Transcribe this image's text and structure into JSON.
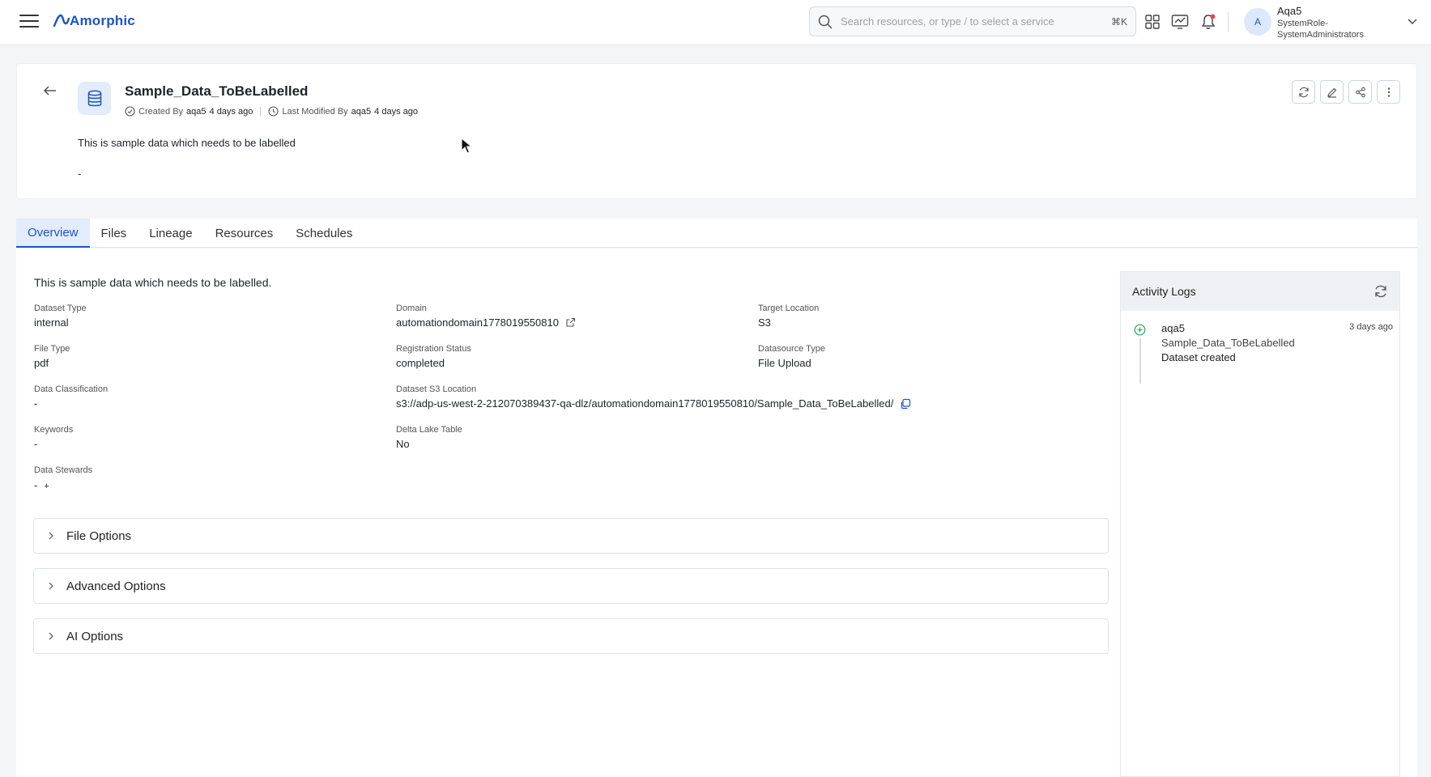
{
  "app": {
    "logo_text": "Amorphic",
    "brand_color": "#1a56c4"
  },
  "topbar": {
    "search_placeholder": "Search resources, or type / to select a service",
    "search_shortcut": "⌘K",
    "icons": [
      "menu-icon",
      "apps-grid-icon",
      "dashboard-chart-icon",
      "notification-bell-icon"
    ],
    "notification_dot_color": "#e5484d",
    "user": {
      "avatar_initial": "A",
      "name": "Aqa5",
      "role": "SystemRole-SystemAdministrators"
    }
  },
  "header": {
    "title": "Sample_Data_ToBeLabelled",
    "created_label": "Created By",
    "created_by": "aqa5",
    "created_ago": "4 days ago",
    "modified_label": "Last Modified By",
    "modified_by": "aqa5",
    "modified_ago": "4 days ago",
    "description": "This is sample data which needs to be labelled",
    "secondary": "-",
    "actions": [
      "refresh-icon",
      "edit-icon",
      "share-icon",
      "more-vertical-icon"
    ]
  },
  "tabs": [
    {
      "label": "Overview",
      "active": true
    },
    {
      "label": "Files",
      "active": false
    },
    {
      "label": "Lineage",
      "active": false
    },
    {
      "label": "Resources",
      "active": false
    },
    {
      "label": "Schedules",
      "active": false
    }
  ],
  "overview": {
    "summary": "This is sample data which needs to be labelled.",
    "fields": {
      "dataset_type": {
        "label": "Dataset Type",
        "value": "internal"
      },
      "file_type": {
        "label": "File Type",
        "value": "pdf"
      },
      "data_classification": {
        "label": "Data Classification",
        "value": "-"
      },
      "keywords": {
        "label": "Keywords",
        "value": "-"
      },
      "data_stewards": {
        "label": "Data Stewards",
        "value": "-",
        "add": "+"
      },
      "domain": {
        "label": "Domain",
        "value": "automationdomain1778019550810"
      },
      "registration_status": {
        "label": "Registration Status",
        "value": "completed"
      },
      "s3_location": {
        "label": "Dataset S3 Location",
        "value": "s3://adp-us-west-2-212070389437-qa-dlz/automationdomain1778019550810/Sample_Data_ToBeLabelled/"
      },
      "delta_lake": {
        "label": "Delta Lake Table",
        "value": "No"
      },
      "target_location": {
        "label": "Target Location",
        "value": "S3"
      },
      "datasource_type": {
        "label": "Datasource Type",
        "value": "File Upload"
      }
    },
    "accordions": [
      "File Options",
      "Advanced Options",
      "AI Options"
    ]
  },
  "activity": {
    "title": "Activity Logs",
    "items": [
      {
        "user": "aqa5",
        "time": "3 days ago",
        "dataset": "Sample_Data_ToBeLabelled",
        "action": "Dataset created",
        "status_color": "#22a559"
      }
    ]
  }
}
